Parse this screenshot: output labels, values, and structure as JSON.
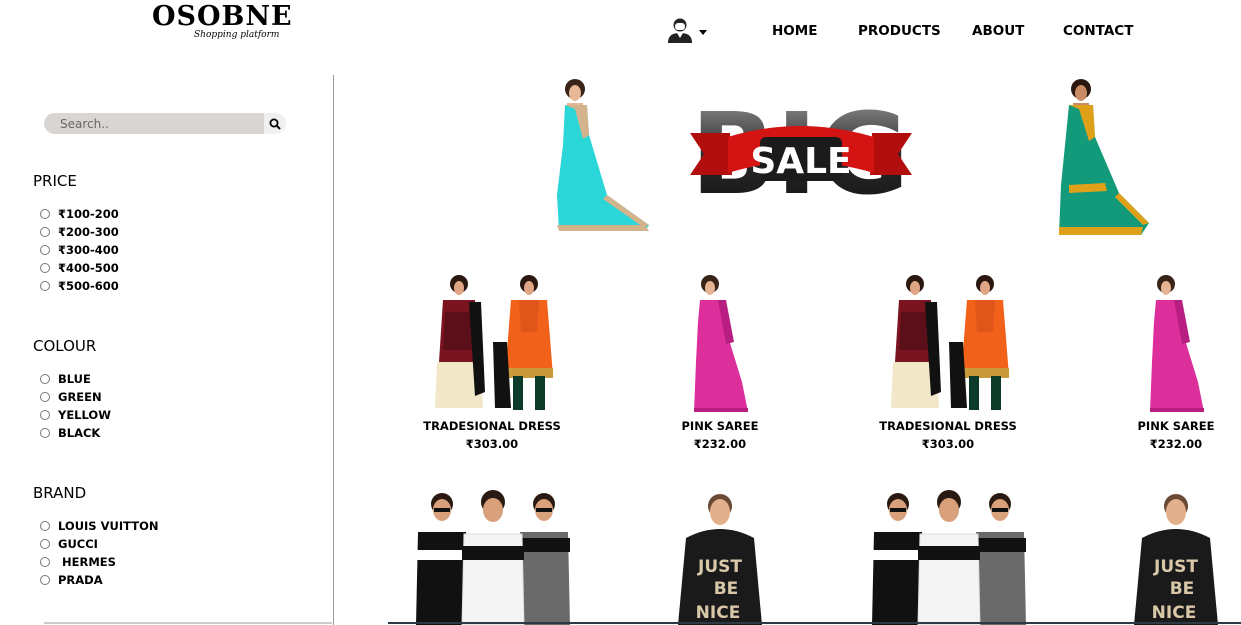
{
  "header": {
    "logo_name": "OSOBNE",
    "logo_tagline": "Shopping platform",
    "nav": [
      "HOME",
      "PRODUCTS",
      "ABOUT",
      "CONTACT"
    ]
  },
  "sidebar": {
    "search_placeholder": "Search..",
    "price": {
      "title": "PRICE",
      "options": [
        "₹100-200",
        "₹200-300",
        "₹300-400",
        "₹400-500",
        "₹500-600"
      ]
    },
    "colour": {
      "title": "COLOUR",
      "options": [
        "BLUE",
        "GREEN",
        "YELLOW",
        "BLACK"
      ]
    },
    "brand": {
      "title": "BRAND",
      "options": [
        "LOUIS VUITTON",
        "GUCCI",
        " HERMES",
        "PRADA"
      ]
    }
  },
  "banner": {
    "big_text": "BIG",
    "sale_text": "SALE"
  },
  "products": [
    {
      "name": "TRADESIONAL DRESS",
      "price": "₹303.00"
    },
    {
      "name": "PINK SAREE",
      "price": "₹232.00"
    },
    {
      "name": "TRADESIONAL DRESS",
      "price": "₹303.00"
    },
    {
      "name": "PINK SAREE",
      "price": "₹232.00"
    }
  ],
  "hoodie_text": [
    "JUST",
    "BE",
    "NICE"
  ],
  "colors": {
    "cyan_saree": "#2ad6d8",
    "green_saree": "#139a7a",
    "pink_saree": "#dc2f9c",
    "sale_red": "#d41313",
    "maroon_dress": "#7a1420",
    "orange_dress": "#f2611a"
  }
}
